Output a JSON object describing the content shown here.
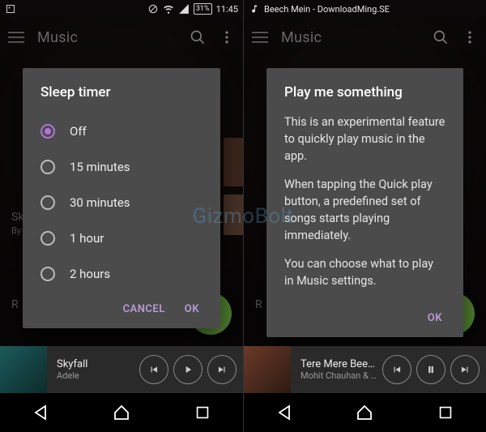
{
  "watermark": "GizmoBolt",
  "left": {
    "status": {
      "time": "11:45",
      "battery": "31%"
    },
    "appbar": {
      "title": "Music"
    },
    "dialog": {
      "title": "Sleep timer",
      "options": [
        "Off",
        "15 minutes",
        "30 minutes",
        "1 hour",
        "2 hours"
      ],
      "selected_index": 0,
      "cancel": "CANCEL",
      "ok": "OK"
    },
    "row_label_top": "R",
    "row_label_mid": "Sk",
    "row_label_mid2": "By",
    "now_playing": {
      "title": "Skyfall",
      "artist": "Adele"
    }
  },
  "right": {
    "status": {
      "nowplaying": "Beech Mein - DownloadMing.SE"
    },
    "appbar": {
      "title": "Music"
    },
    "dialog": {
      "title": "Play me something",
      "p1": "This is an experimental feature to quickly play music in the app.",
      "p2": "When tapping the Quick play button, a predefined set of songs starts playing immediately.",
      "p3": "You can choose what to play in Music settings.",
      "ok": "OK"
    },
    "row_label_top": "R",
    "now_playing": {
      "title": "Tere Mere Beech Me",
      "artist": "Mohit Chauhan & Sunid"
    }
  }
}
